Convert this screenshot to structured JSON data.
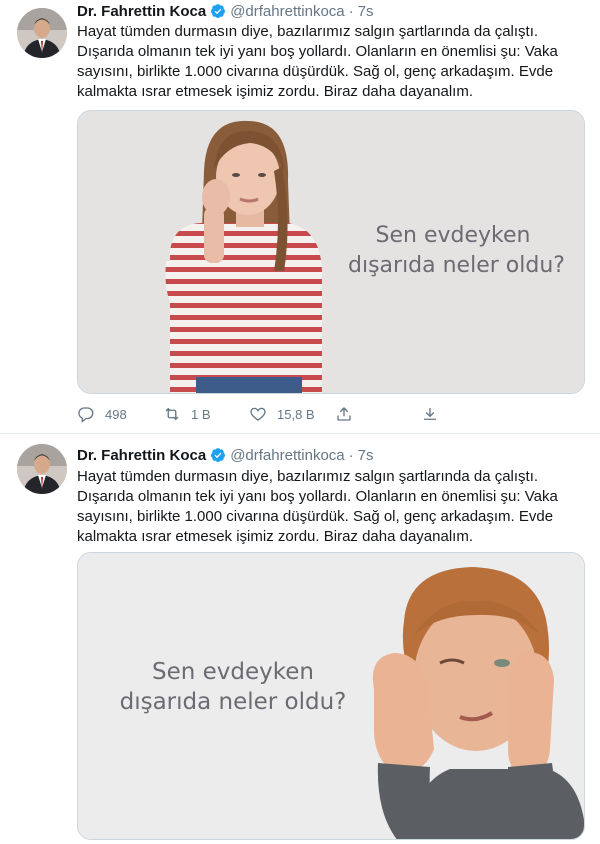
{
  "colors": {
    "verified": "#1da1f2",
    "secondary_text": "#657786",
    "primary_text": "#14171a",
    "divider": "#e6ecf0"
  },
  "tweets": [
    {
      "name": "Dr. Fahrettin Koca",
      "handle": "@drfahrettinkoca",
      "separator": "·",
      "time": "7s",
      "text": "Hayat tümden durmasın diye, bazılarımız salgın şartlarında da çalıştı. Dışarıda olmanın tek iyi yanı boş yollardı. Olanların en önemlisi şu: Vaka sayısını, birlikte 1.000 civarına düşürdük. Sağ ol, genç arkadaşım. Evde kalmakta ısrar etmesek işimiz zordu. Biraz daha dayanalım.",
      "image_caption_line1": "Sen evdeyken",
      "image_caption_line2": "dışarıda neler oldu?",
      "replies": "498",
      "retweets": "1 B",
      "likes": "15,8 B"
    },
    {
      "name": "Dr. Fahrettin Koca",
      "handle": "@drfahrettinkoca",
      "separator": "·",
      "time": "7s",
      "text": "Hayat tümden durmasın diye, bazılarımız salgın şartlarında da çalıştı. Dışarıda olmanın tek iyi yanı boş yollardı. Olanların en önemlisi şu: Vaka sayısını, birlikte 1.000 civarına düşürdük. Sağ ol, genç arkadaşım. Evde kalmakta ısrar etmesek işimiz zordu. Biraz daha dayanalım.",
      "image_caption_line1": "Sen evdeyken",
      "image_caption_line2": "dışarıda neler oldu?"
    }
  ]
}
